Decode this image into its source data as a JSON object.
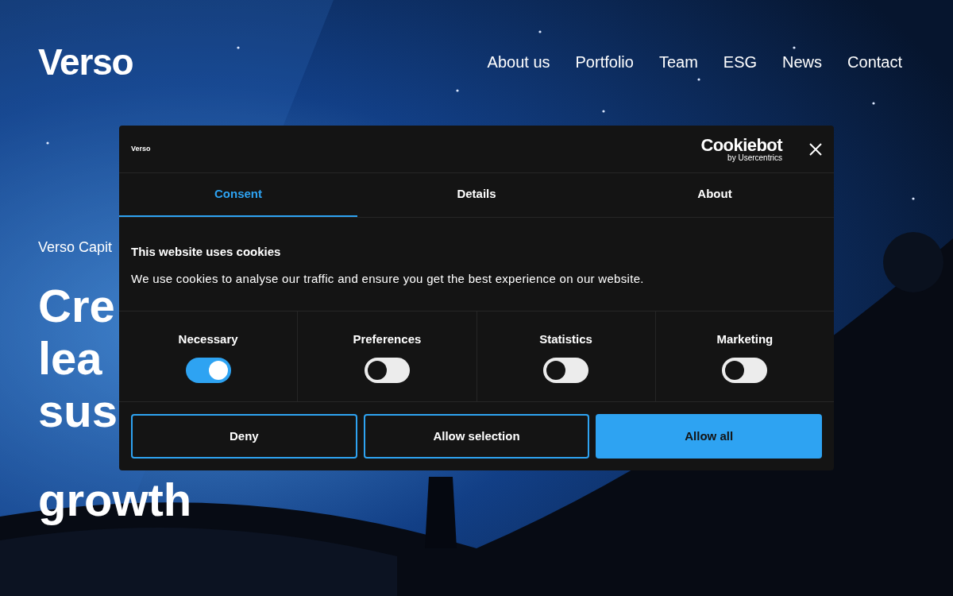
{
  "header": {
    "logo": "Verso",
    "nav": [
      {
        "label": "About us"
      },
      {
        "label": "Portfolio"
      },
      {
        "label": "Team"
      },
      {
        "label": "ESG"
      },
      {
        "label": "News"
      },
      {
        "label": "Contact"
      }
    ]
  },
  "hero": {
    "eyebrow": "Verso Capit",
    "heading_lines": [
      "Cre",
      "lea",
      "sus",
      "growth"
    ]
  },
  "consent_dialog": {
    "brand": "Verso",
    "provider": {
      "name": "Cookiebot",
      "byline": "by Usercentrics"
    },
    "tabs": [
      {
        "label": "Consent",
        "selected": true
      },
      {
        "label": "Details",
        "selected": false
      },
      {
        "label": "About",
        "selected": false
      }
    ],
    "title": "This website uses cookies",
    "text": "We use cookies to analyse our traffic and ensure you get the best experience on our website.",
    "categories": [
      {
        "label": "Necessary",
        "checked": true
      },
      {
        "label": "Preferences",
        "checked": false
      },
      {
        "label": "Statistics",
        "checked": false
      },
      {
        "label": "Marketing",
        "checked": false
      }
    ],
    "buttons": [
      {
        "label": "Deny",
        "kind": "outline"
      },
      {
        "label": "Allow selection",
        "kind": "outline"
      },
      {
        "label": "Allow all",
        "kind": "filled"
      }
    ]
  }
}
